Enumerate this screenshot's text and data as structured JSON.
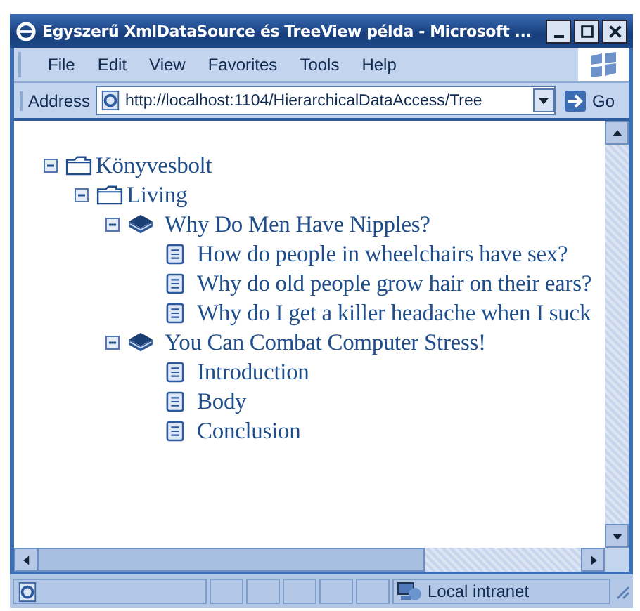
{
  "window": {
    "title": "Egyszerű XmlDataSource és TreeView példa - Microsoft ..."
  },
  "menu": [
    "File",
    "Edit",
    "View",
    "Favorites",
    "Tools",
    "Help"
  ],
  "address": {
    "label": "Address",
    "value": "http://localhost:1104/HierarchicalDataAccess/Tree",
    "go": "Go"
  },
  "tree": [
    {
      "label": "Könyvesbolt",
      "kind": "folder",
      "expanded": true,
      "children": [
        {
          "label": "Living",
          "kind": "folder",
          "expanded": true,
          "children": [
            {
              "label": "Why Do Men Have Nipples?",
              "kind": "book",
              "expanded": true,
              "children": [
                {
                  "label": "How do people in wheelchairs have sex?",
                  "kind": "page"
                },
                {
                  "label": "Why do old people grow hair on their ears?",
                  "kind": "page"
                },
                {
                  "label": "Why do I get a killer headache when I suck",
                  "kind": "page"
                }
              ]
            },
            {
              "label": "You Can Combat Computer Stress!",
              "kind": "book",
              "expanded": true,
              "children": [
                {
                  "label": "Introduction",
                  "kind": "page"
                },
                {
                  "label": "Body",
                  "kind": "page"
                },
                {
                  "label": "Conclusion",
                  "kind": "page"
                }
              ]
            }
          ]
        }
      ]
    }
  ],
  "status_bar": {
    "zone": "Local intranet"
  }
}
